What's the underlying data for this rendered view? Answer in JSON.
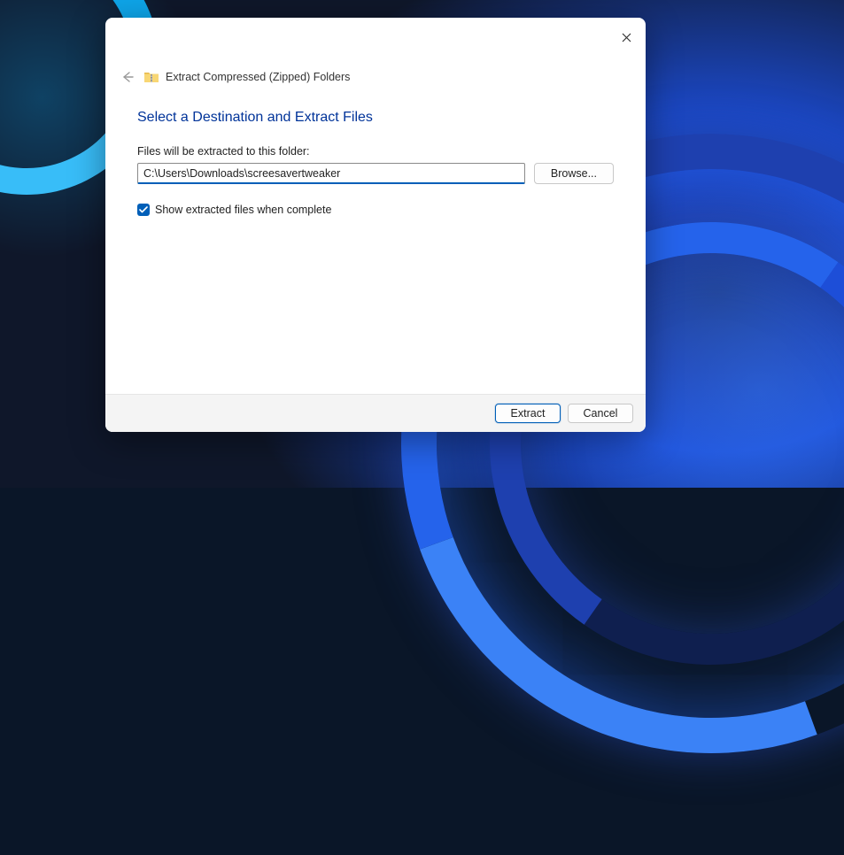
{
  "header": {
    "title": "Extract Compressed (Zipped) Folders"
  },
  "body": {
    "heading": "Select a Destination and Extract Files",
    "field_label": "Files will be extracted to this folder:",
    "path_value": "C:\\Users\\Downloads\\screesavertweaker",
    "browse_label": "Browse...",
    "checkbox_label": "Show extracted files when complete",
    "checkbox_checked": true
  },
  "footer": {
    "extract_label": "Extract",
    "cancel_label": "Cancel"
  }
}
